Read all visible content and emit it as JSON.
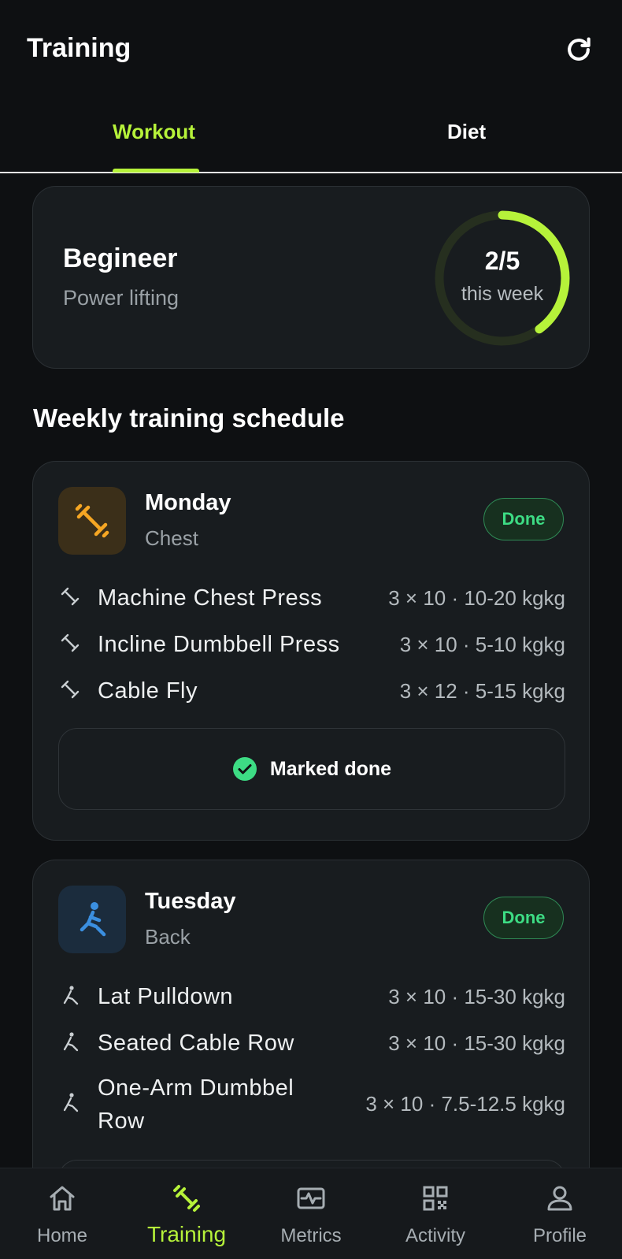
{
  "header": {
    "title": "Training"
  },
  "tabs": [
    {
      "label": "Workout",
      "active": true
    },
    {
      "label": "Diet",
      "active": false
    }
  ],
  "summary": {
    "level": "Begineer",
    "program": "Power lifting",
    "progress": {
      "label": "2/5",
      "sub": "this week",
      "completed": 2,
      "total": 5
    }
  },
  "section_title": "Weekly training schedule",
  "days": [
    {
      "day": "Monday",
      "focus": "Chest",
      "status": "Done",
      "exercises": [
        {
          "name": "Machine Chest Press",
          "detail": "3 × 10 · 10-20 kgkg"
        },
        {
          "name": "Incline Dumbbell Press",
          "detail": "3 × 10 · 5-10 kgkg"
        },
        {
          "name": "Cable Fly",
          "detail": "3 × 12 · 5-15 kgkg"
        }
      ],
      "action_label": "Marked done"
    },
    {
      "day": "Tuesday",
      "focus": "Back",
      "status": "Done",
      "exercises": [
        {
          "name": "Lat Pulldown",
          "detail": "3 × 10 · 15-30 kgkg"
        },
        {
          "name": "Seated Cable Row",
          "detail": "3 × 10 · 15-30 kgkg"
        },
        {
          "name": "One-Arm Dumbbel Row",
          "detail": "3 × 10 · 7.5-12.5 kgkg"
        }
      ]
    }
  ],
  "bottom_nav": [
    {
      "label": "Home",
      "icon": "home-icon",
      "active": false
    },
    {
      "label": "Training",
      "icon": "dumbbell-icon",
      "active": true
    },
    {
      "label": "Metrics",
      "icon": "pulse-icon",
      "active": false
    },
    {
      "label": "Activity",
      "icon": "qr-code-icon",
      "active": false
    },
    {
      "label": "Profile",
      "icon": "person-icon",
      "active": false
    }
  ],
  "colors": {
    "accent": "#b6f23a",
    "done_green": "#3ddc84",
    "chest_orange": "#f5a623",
    "back_blue": "#3b8fe0"
  }
}
